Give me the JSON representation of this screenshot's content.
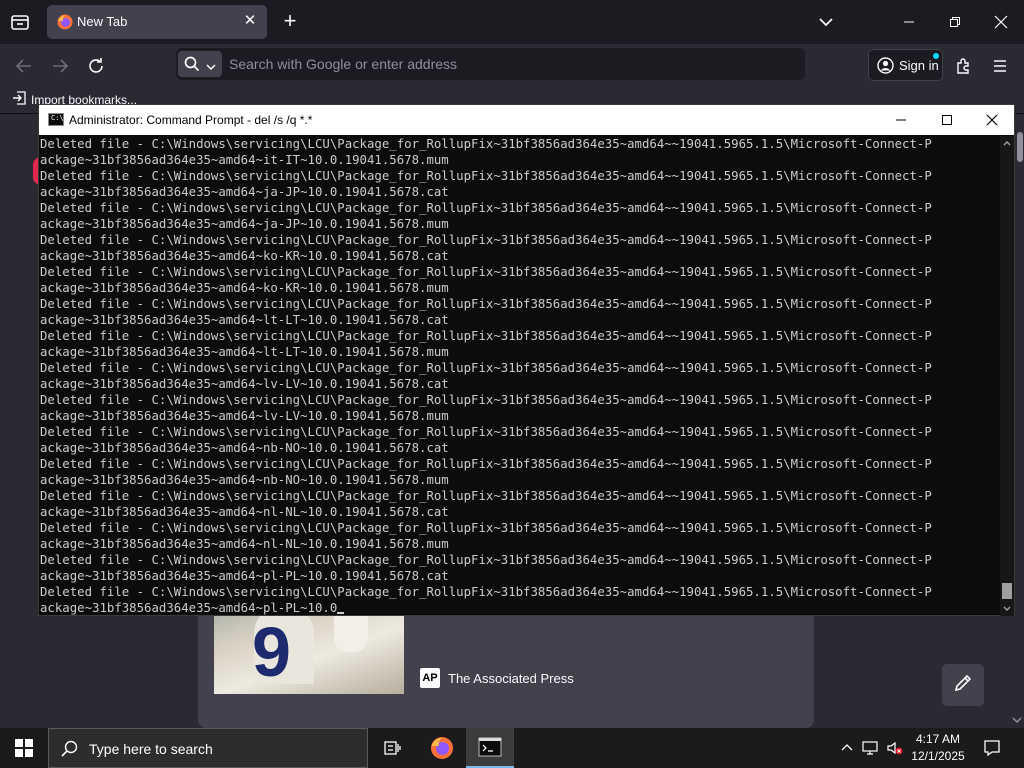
{
  "browser": {
    "tab_title": "New Tab",
    "url_placeholder": "Search with Google or enter address",
    "sign_in_label": "Sign in",
    "import_bookmarks_label": "Import bookmarks...",
    "story_source": "The Associated Press",
    "story_logo_text": "AP",
    "story_image_number": "9"
  },
  "console": {
    "title": "Administrator: Command Prompt - del  /s /q *.*",
    "icon_text": "C:\\",
    "prefix": "Deleted file - C:\\Windows\\servicing\\LCU\\Package_for_RollupFix~31bf3856ad364e35~amd64~~19041.5965.1.5\\Microsoft-Connect-P",
    "lines": [
      "Deleted file - C:\\Windows\\servicing\\LCU\\Package_for_RollupFix~31bf3856ad364e35~amd64~~19041.5965.1.5\\Microsoft-Connect-P",
      "ackage~31bf3856ad364e35~amd64~it-IT~10.0.19041.5678.mum",
      "Deleted file - C:\\Windows\\servicing\\LCU\\Package_for_RollupFix~31bf3856ad364e35~amd64~~19041.5965.1.5\\Microsoft-Connect-P",
      "ackage~31bf3856ad364e35~amd64~ja-JP~10.0.19041.5678.cat",
      "Deleted file - C:\\Windows\\servicing\\LCU\\Package_for_RollupFix~31bf3856ad364e35~amd64~~19041.5965.1.5\\Microsoft-Connect-P",
      "ackage~31bf3856ad364e35~amd64~ja-JP~10.0.19041.5678.mum",
      "Deleted file - C:\\Windows\\servicing\\LCU\\Package_for_RollupFix~31bf3856ad364e35~amd64~~19041.5965.1.5\\Microsoft-Connect-P",
      "ackage~31bf3856ad364e35~amd64~ko-KR~10.0.19041.5678.cat",
      "Deleted file - C:\\Windows\\servicing\\LCU\\Package_for_RollupFix~31bf3856ad364e35~amd64~~19041.5965.1.5\\Microsoft-Connect-P",
      "ackage~31bf3856ad364e35~amd64~ko-KR~10.0.19041.5678.mum",
      "Deleted file - C:\\Windows\\servicing\\LCU\\Package_for_RollupFix~31bf3856ad364e35~amd64~~19041.5965.1.5\\Microsoft-Connect-P",
      "ackage~31bf3856ad364e35~amd64~lt-LT~10.0.19041.5678.cat",
      "Deleted file - C:\\Windows\\servicing\\LCU\\Package_for_RollupFix~31bf3856ad364e35~amd64~~19041.5965.1.5\\Microsoft-Connect-P",
      "ackage~31bf3856ad364e35~amd64~lt-LT~10.0.19041.5678.mum",
      "Deleted file - C:\\Windows\\servicing\\LCU\\Package_for_RollupFix~31bf3856ad364e35~amd64~~19041.5965.1.5\\Microsoft-Connect-P",
      "ackage~31bf3856ad364e35~amd64~lv-LV~10.0.19041.5678.cat",
      "Deleted file - C:\\Windows\\servicing\\LCU\\Package_for_RollupFix~31bf3856ad364e35~amd64~~19041.5965.1.5\\Microsoft-Connect-P",
      "ackage~31bf3856ad364e35~amd64~lv-LV~10.0.19041.5678.mum",
      "Deleted file - C:\\Windows\\servicing\\LCU\\Package_for_RollupFix~31bf3856ad364e35~amd64~~19041.5965.1.5\\Microsoft-Connect-P",
      "ackage~31bf3856ad364e35~amd64~nb-NO~10.0.19041.5678.cat",
      "Deleted file - C:\\Windows\\servicing\\LCU\\Package_for_RollupFix~31bf3856ad364e35~amd64~~19041.5965.1.5\\Microsoft-Connect-P",
      "ackage~31bf3856ad364e35~amd64~nb-NO~10.0.19041.5678.mum",
      "Deleted file - C:\\Windows\\servicing\\LCU\\Package_for_RollupFix~31bf3856ad364e35~amd64~~19041.5965.1.5\\Microsoft-Connect-P",
      "ackage~31bf3856ad364e35~amd64~nl-NL~10.0.19041.5678.cat",
      "Deleted file - C:\\Windows\\servicing\\LCU\\Package_for_RollupFix~31bf3856ad364e35~amd64~~19041.5965.1.5\\Microsoft-Connect-P",
      "ackage~31bf3856ad364e35~amd64~nl-NL~10.0.19041.5678.mum",
      "Deleted file - C:\\Windows\\servicing\\LCU\\Package_for_RollupFix~31bf3856ad364e35~amd64~~19041.5965.1.5\\Microsoft-Connect-P",
      "ackage~31bf3856ad364e35~amd64~pl-PL~10.0.19041.5678.cat",
      "Deleted file - C:\\Windows\\servicing\\LCU\\Package_for_RollupFix~31bf3856ad364e35~amd64~~19041.5965.1.5\\Microsoft-Connect-P",
      "ackage~31bf3856ad364e35~amd64~pl-PL~10.0"
    ]
  },
  "taskbar": {
    "search_placeholder": "Type here to search",
    "time": "4:17 AM",
    "date": "12/1/2025"
  },
  "colors": {
    "console_bg": "#0c0c0c",
    "console_text": "#cccccc",
    "firefox_dark": "#1c1b22",
    "firefox_toolbar": "#2b2a33",
    "accent_blue": "#76b9ed"
  }
}
